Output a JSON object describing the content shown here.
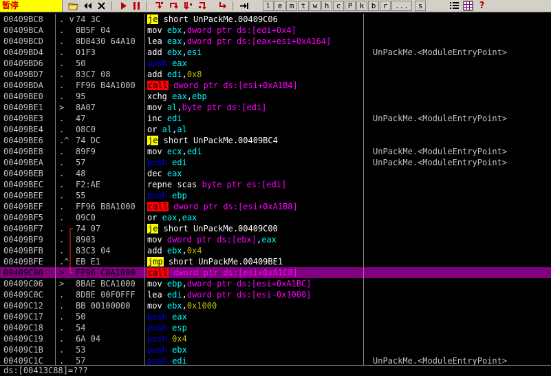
{
  "toolbar": {
    "status": "暂停",
    "letters": [
      "l",
      "e",
      "m",
      "t",
      "w",
      "h",
      "c",
      "P",
      "k",
      "b",
      "r",
      "...",
      "s"
    ],
    "colors": {
      "status_bg": "#ffff00",
      "status_fg": "#e00000",
      "bar_bg": "#d4d0c8"
    }
  },
  "listing": {
    "rows": [
      {
        "addr": "00409BC8",
        "mark": ". v",
        "hex": "74 3C",
        "asm": [
          {
            "t": "je",
            "k": "jcc"
          },
          {
            "t": " short ",
            "k": "kw"
          },
          {
            "t": "UnPackMe.00409C06",
            "k": "tgt"
          }
        ],
        "cmt": ""
      },
      {
        "addr": "00409BCA",
        "mark": ".",
        "hex": "8B5F 04",
        "asm": [
          {
            "t": "mov",
            "k": "plain"
          },
          {
            "t": " ebx",
            "k": "reg"
          },
          {
            "t": ",",
            "k": "kw"
          },
          {
            "t": "dword ptr ds:[edi+0x4]",
            "k": "mem"
          }
        ],
        "cmt": ""
      },
      {
        "addr": "00409BCD",
        "mark": ".",
        "hex": "8D8430 64A10",
        "asm": [
          {
            "t": "lea",
            "k": "plain"
          },
          {
            "t": " eax",
            "k": "reg"
          },
          {
            "t": ",",
            "k": "kw"
          },
          {
            "t": "dword ptr ds:[eax+esi+0xA164]",
            "k": "mem"
          }
        ],
        "cmt": ""
      },
      {
        "addr": "00409BD4",
        "mark": ".",
        "hex": "01F3",
        "asm": [
          {
            "t": "add",
            "k": "plain"
          },
          {
            "t": " ebx",
            "k": "reg"
          },
          {
            "t": ",",
            "k": "kw"
          },
          {
            "t": "esi",
            "k": "reg"
          }
        ],
        "cmt": "UnPackMe.<ModuleEntryPoint>"
      },
      {
        "addr": "00409BD6",
        "mark": ".",
        "hex": "50",
        "asm": [
          {
            "t": "push",
            "k": "push"
          },
          {
            "t": " eax",
            "k": "reg"
          }
        ],
        "cmt": ""
      },
      {
        "addr": "00409BD7",
        "mark": ".",
        "hex": "83C7 08",
        "asm": [
          {
            "t": "add",
            "k": "plain"
          },
          {
            "t": " edi",
            "k": "reg"
          },
          {
            "t": ",",
            "k": "kw"
          },
          {
            "t": "0x8",
            "k": "imm"
          }
        ],
        "cmt": ""
      },
      {
        "addr": "00409BDA",
        "mark": ".",
        "hex": "FF96 B4A1000",
        "asm": [
          {
            "t": "call",
            "k": "call"
          },
          {
            "t": " dword ptr ds:[esi+0xA1B4]",
            "k": "mem"
          }
        ],
        "cmt": ""
      },
      {
        "addr": "00409BE0",
        "mark": ".",
        "hex": "95",
        "asm": [
          {
            "t": "xchg",
            "k": "plain"
          },
          {
            "t": " eax",
            "k": "reg"
          },
          {
            "t": ",",
            "k": "kw"
          },
          {
            "t": "ebp",
            "k": "reg"
          }
        ],
        "cmt": ""
      },
      {
        "addr": "00409BE1",
        "mark": ">",
        "hex": "8A07",
        "asm": [
          {
            "t": "mov",
            "k": "plain"
          },
          {
            "t": " al",
            "k": "reg"
          },
          {
            "t": ",",
            "k": "kw"
          },
          {
            "t": "byte ptr ds:[edi]",
            "k": "mem"
          }
        ],
        "cmt": ""
      },
      {
        "addr": "00409BE3",
        "mark": ".",
        "hex": "47",
        "asm": [
          {
            "t": "inc",
            "k": "plain"
          },
          {
            "t": " edi",
            "k": "reg"
          }
        ],
        "cmt": "UnPackMe.<ModuleEntryPoint>"
      },
      {
        "addr": "00409BE4",
        "mark": ".",
        "hex": "08C0",
        "asm": [
          {
            "t": "or",
            "k": "plain"
          },
          {
            "t": " al",
            "k": "reg"
          },
          {
            "t": ",",
            "k": "kw"
          },
          {
            "t": "al",
            "k": "reg"
          }
        ],
        "cmt": ""
      },
      {
        "addr": "00409BE6",
        "mark": ".^",
        "hex": "74 DC",
        "asm": [
          {
            "t": "je",
            "k": "jcc"
          },
          {
            "t": " short ",
            "k": "kw"
          },
          {
            "t": "UnPackMe.00409BC4",
            "k": "tgt"
          }
        ],
        "cmt": ""
      },
      {
        "addr": "00409BE8",
        "mark": ".",
        "hex": "89F9",
        "asm": [
          {
            "t": "mov",
            "k": "plain"
          },
          {
            "t": " ecx",
            "k": "reg"
          },
          {
            "t": ",",
            "k": "kw"
          },
          {
            "t": "edi",
            "k": "reg"
          }
        ],
        "cmt": "UnPackMe.<ModuleEntryPoint>"
      },
      {
        "addr": "00409BEA",
        "mark": ".",
        "hex": "57",
        "asm": [
          {
            "t": "push",
            "k": "push"
          },
          {
            "t": " edi",
            "k": "reg"
          }
        ],
        "cmt": "UnPackMe.<ModuleEntryPoint>"
      },
      {
        "addr": "00409BEB",
        "mark": ".",
        "hex": "48",
        "asm": [
          {
            "t": "dec",
            "k": "plain"
          },
          {
            "t": " eax",
            "k": "reg"
          }
        ],
        "cmt": ""
      },
      {
        "addr": "00409BEC",
        "mark": ".",
        "hex": "F2:AE",
        "asm": [
          {
            "t": "repne scas",
            "k": "plain"
          },
          {
            "t": " byte ptr es:[edi]",
            "k": "mem"
          }
        ],
        "cmt": ""
      },
      {
        "addr": "00409BEE",
        "mark": ".",
        "hex": "55",
        "asm": [
          {
            "t": "push",
            "k": "push"
          },
          {
            "t": " ebp",
            "k": "reg"
          }
        ],
        "cmt": ""
      },
      {
        "addr": "00409BEF",
        "mark": ".",
        "hex": "FF96 B8A1000",
        "asm": [
          {
            "t": "call",
            "k": "call"
          },
          {
            "t": " dword ptr ds:[esi+0xA1B8]",
            "k": "mem"
          }
        ],
        "cmt": ""
      },
      {
        "addr": "00409BF5",
        "mark": ".",
        "hex": "09C0",
        "asm": [
          {
            "t": "or",
            "k": "plain"
          },
          {
            "t": " eax",
            "k": "reg"
          },
          {
            "t": ",",
            "k": "kw"
          },
          {
            "t": "eax",
            "k": "reg"
          }
        ],
        "cmt": ""
      },
      {
        "addr": "00409BF7",
        "mark": ".",
        "hex": "74 07",
        "asm": [
          {
            "t": "je",
            "k": "jcc"
          },
          {
            "t": " short ",
            "k": "kw"
          },
          {
            "t": "UnPackMe.00409C00",
            "k": "tgt"
          }
        ],
        "cmt": ""
      },
      {
        "addr": "00409BF9",
        "mark": ".",
        "hex": "8903",
        "asm": [
          {
            "t": "mov",
            "k": "plain"
          },
          {
            "t": " dword ptr ds:[ebx]",
            "k": "mem"
          },
          {
            "t": ",",
            "k": "kw"
          },
          {
            "t": "eax",
            "k": "reg"
          }
        ],
        "cmt": ""
      },
      {
        "addr": "00409BFB",
        "mark": ".",
        "hex": "83C3 04",
        "asm": [
          {
            "t": "add",
            "k": "plain"
          },
          {
            "t": " ebx",
            "k": "reg"
          },
          {
            "t": ",",
            "k": "kw"
          },
          {
            "t": "0x4",
            "k": "imm"
          }
        ],
        "cmt": ""
      },
      {
        "addr": "00409BFE",
        "mark": ".^",
        "hex": "EB E1",
        "asm": [
          {
            "t": "jmp",
            "k": "jmp"
          },
          {
            "t": " short ",
            "k": "kw"
          },
          {
            "t": "UnPackMe.00409BE1",
            "k": "tgt"
          }
        ],
        "cmt": ""
      },
      {
        "addr": "00409C00",
        "mark": ">",
        "hex": "FF96 C8A1000",
        "asm": [
          {
            "t": "call",
            "k": "call"
          },
          {
            "t": " dword ptr ds:[esi+0xA1C8]",
            "k": "mem"
          }
        ],
        "cmt": "",
        "selected": true
      },
      {
        "addr": "00409C06",
        "mark": ">",
        "hex": "8BAE BCA1000",
        "asm": [
          {
            "t": "mov",
            "k": "plain"
          },
          {
            "t": " ebp",
            "k": "reg"
          },
          {
            "t": ",",
            "k": "kw"
          },
          {
            "t": "dword ptr ds:[esi+0xA1BC]",
            "k": "mem"
          }
        ],
        "cmt": ""
      },
      {
        "addr": "00409C0C",
        "mark": ".",
        "hex": "8DBE 00F0FFF",
        "asm": [
          {
            "t": "lea",
            "k": "plain"
          },
          {
            "t": " edi",
            "k": "reg"
          },
          {
            "t": ",",
            "k": "kw"
          },
          {
            "t": "dword ptr ds:[esi-0x1000]",
            "k": "mem"
          }
        ],
        "cmt": ""
      },
      {
        "addr": "00409C12",
        "mark": ".",
        "hex": "BB 00100000",
        "asm": [
          {
            "t": "mov",
            "k": "plain"
          },
          {
            "t": " ebx",
            "k": "reg"
          },
          {
            "t": ",",
            "k": "kw"
          },
          {
            "t": "0x1000",
            "k": "imm"
          }
        ],
        "cmt": ""
      },
      {
        "addr": "00409C17",
        "mark": ".",
        "hex": "50",
        "asm": [
          {
            "t": "push",
            "k": "push"
          },
          {
            "t": " eax",
            "k": "reg"
          }
        ],
        "cmt": ""
      },
      {
        "addr": "00409C18",
        "mark": ".",
        "hex": "54",
        "asm": [
          {
            "t": "push",
            "k": "push"
          },
          {
            "t": " esp",
            "k": "reg"
          }
        ],
        "cmt": ""
      },
      {
        "addr": "00409C19",
        "mark": ".",
        "hex": "6A 04",
        "asm": [
          {
            "t": "push",
            "k": "push"
          },
          {
            "t": " 0x4",
            "k": "imm"
          }
        ],
        "cmt": ""
      },
      {
        "addr": "00409C1B",
        "mark": ".",
        "hex": "53",
        "asm": [
          {
            "t": "push",
            "k": "push"
          },
          {
            "t": " ebx",
            "k": "reg"
          }
        ],
        "cmt": ""
      },
      {
        "addr": "00409C1C",
        "mark": ".",
        "hex": "57",
        "asm": [
          {
            "t": "push",
            "k": "push"
          },
          {
            "t": " edi",
            "k": "reg"
          }
        ],
        "cmt": "UnPackMe.<ModuleEntryPoint>"
      }
    ]
  },
  "infobar": {
    "text": "ds:[00413C88]=???"
  }
}
